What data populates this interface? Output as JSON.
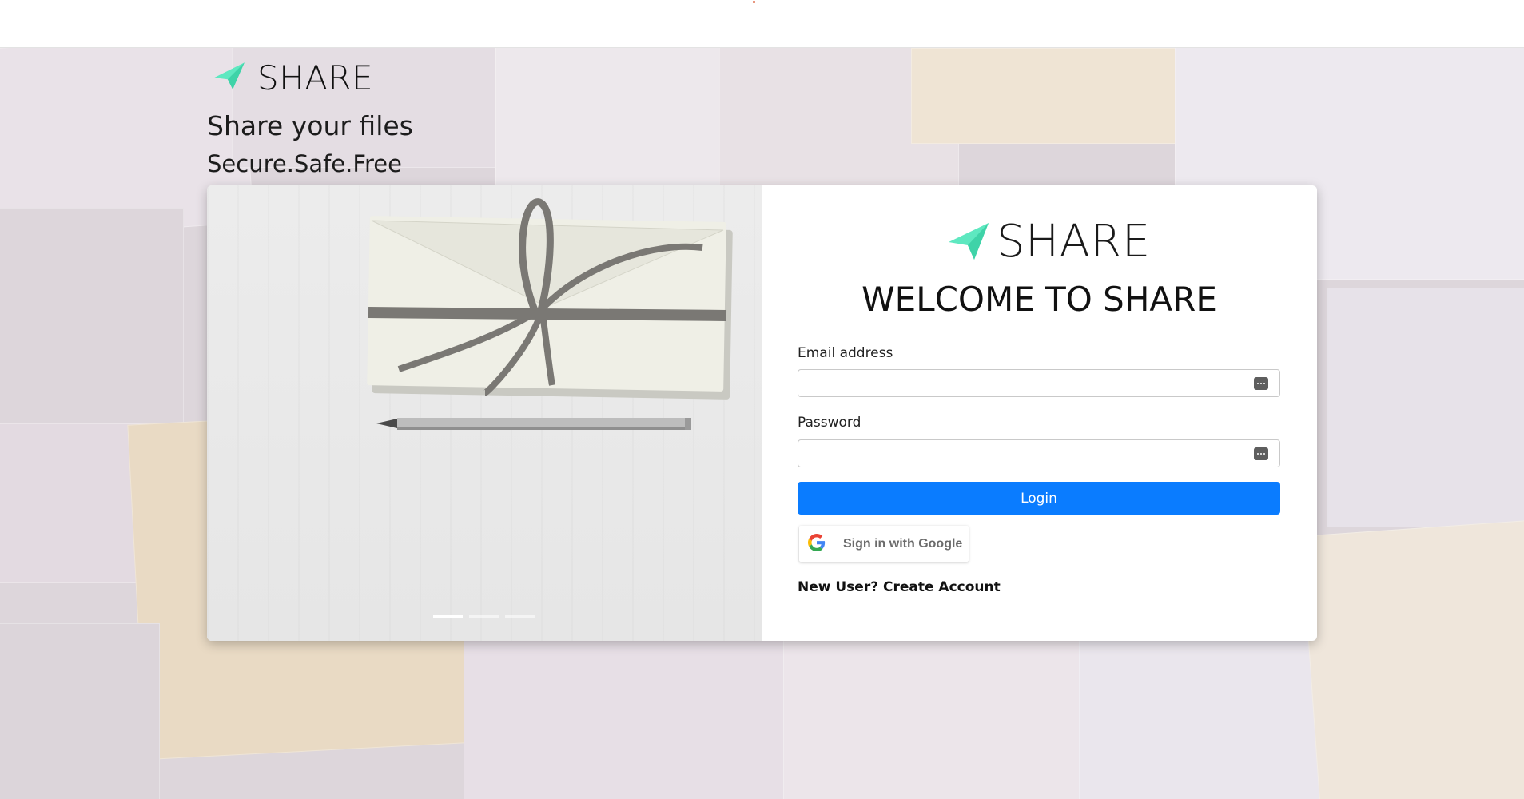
{
  "brand": {
    "name": "SHARE",
    "logo_icon": "paper-plane-icon",
    "logo_color": "#5ee8c0"
  },
  "hero": {
    "tagline": "Share your files",
    "subtagline": "Secure.Safe.Free"
  },
  "carousel": {
    "slide_count": 3,
    "active_index": 0
  },
  "login": {
    "welcome": "WELCOME TO SHARE",
    "email_label": "Email address",
    "email_value": "",
    "password_label": "Password",
    "password_value": "",
    "login_button": "Login",
    "google_button": "Sign in with Google",
    "create_account": "New User? Create Account"
  },
  "colors": {
    "primary": "#0a7cff",
    "brand_accent": "#5ee8c0"
  }
}
